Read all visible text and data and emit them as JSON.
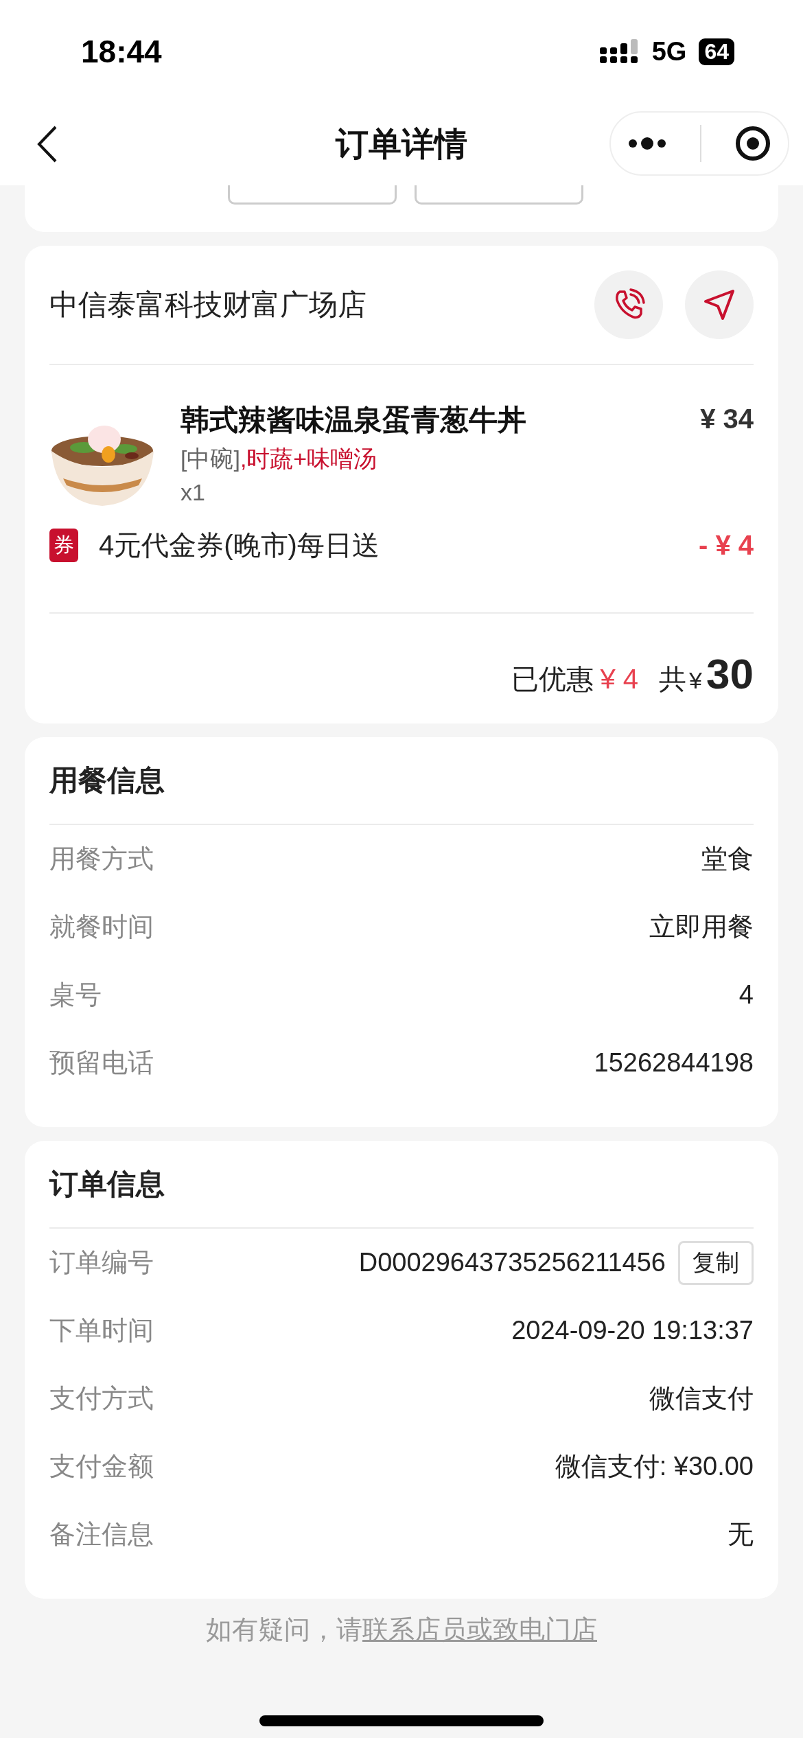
{
  "status_bar": {
    "time": "18:44",
    "network": "5G",
    "battery": "64"
  },
  "nav": {
    "title": "订单详情"
  },
  "top_card": {
    "buttons": [
      {
        "kind": "outline"
      },
      {
        "kind": "outline"
      }
    ]
  },
  "store": {
    "name": "中信泰富科技财富广场店",
    "item": {
      "name": "韩式辣酱味温泉蛋青葱牛丼",
      "size": "[中碗]",
      "extras": ",时蔬+味噌汤",
      "qty": "x1",
      "price": "¥ 34"
    },
    "coupon": {
      "badge": "券",
      "text": "4元代金券(晚市)每日送",
      "amount": "- ¥ 4"
    },
    "summary": {
      "discount_label": "已优惠",
      "discount": "¥ 4",
      "total_label": "共",
      "currency": "¥",
      "total": "30"
    }
  },
  "sections": [
    {
      "title": "用餐信息",
      "rows": [
        {
          "label": "用餐方式",
          "value": "堂食"
        },
        {
          "label": "就餐时间",
          "value": "立即用餐"
        },
        {
          "label": "桌号",
          "value": "4"
        },
        {
          "label": "预留电话",
          "value": "15262844198"
        }
      ]
    },
    {
      "title": "订单信息",
      "rows": [
        {
          "label": "订单编号",
          "value": "D00029643735256211456",
          "action": "复制"
        },
        {
          "label": "下单时间",
          "value": "2024-09-20 19:13:37"
        },
        {
          "label": "支付方式",
          "value": "微信支付"
        },
        {
          "label": "支付金额",
          "value": "微信支付: ¥30.00"
        },
        {
          "label": "备注信息",
          "value": "无"
        }
      ]
    }
  ],
  "footer": {
    "text": "如有疑问，请",
    "link": "联系店员或致电门店"
  }
}
